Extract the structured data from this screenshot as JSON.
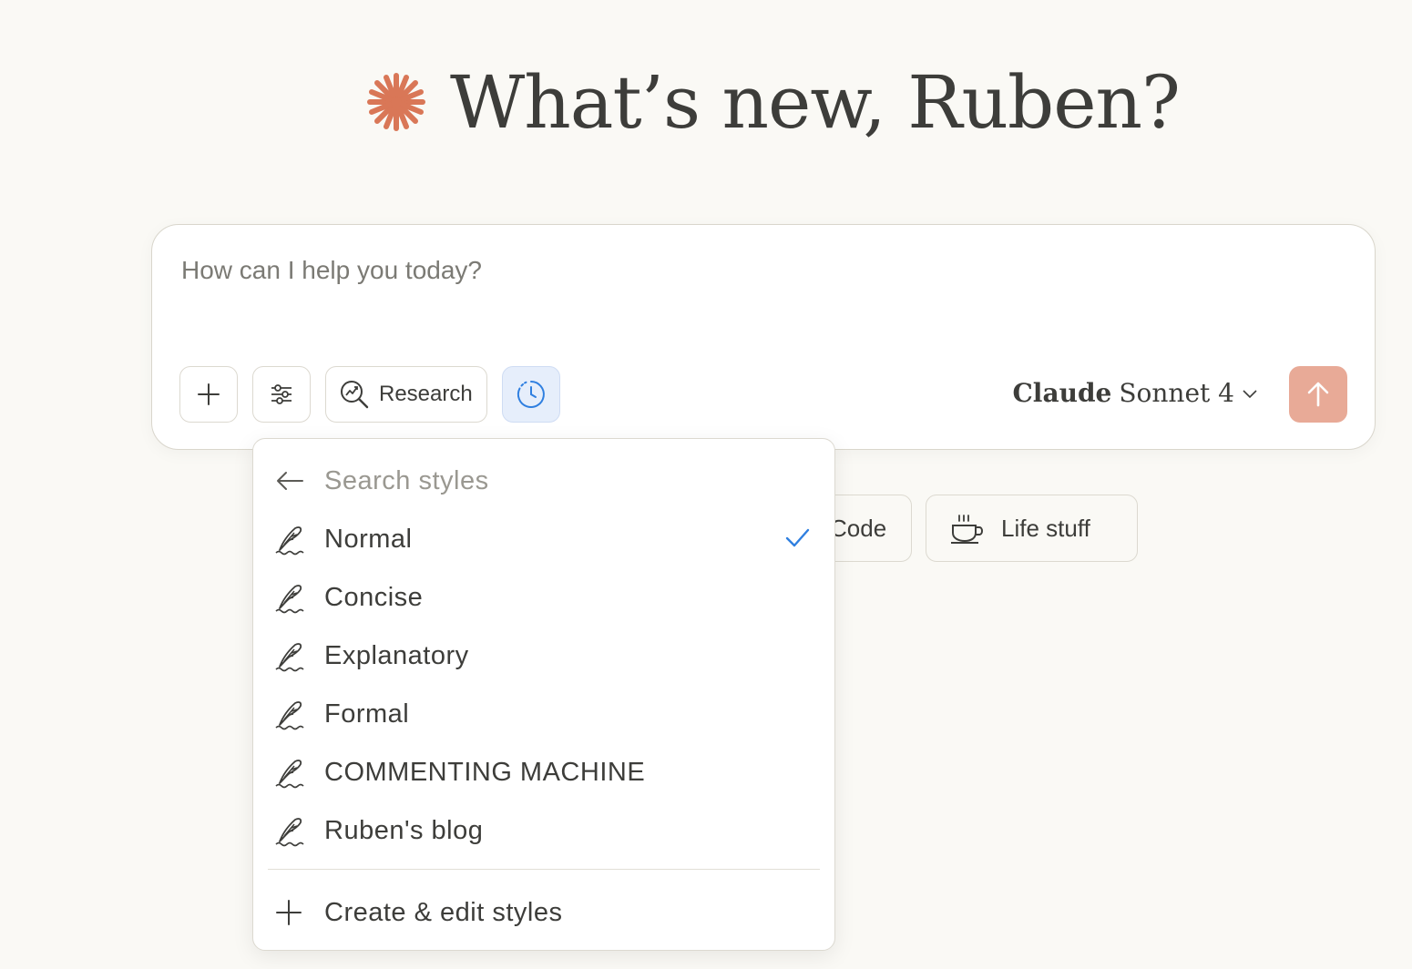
{
  "greeting": {
    "text": "What’s new, Ruben?",
    "accent": "#d97757"
  },
  "composer": {
    "placeholder": "How can I help you today?",
    "research_label": "Research",
    "model_brand": "Claude",
    "model_name": "Sonnet 4",
    "send_color": "#e8aa97"
  },
  "chips": [
    {
      "label": "Code",
      "icon": "code-icon"
    },
    {
      "label": "Life stuff",
      "icon": "coffee-cup-icon"
    }
  ],
  "styles_menu": {
    "search_placeholder": "Search styles",
    "items": [
      {
        "label": "Normal",
        "selected": true,
        "icon": "quill-icon"
      },
      {
        "label": "Concise",
        "selected": false,
        "icon": "quill-icon"
      },
      {
        "label": "Explanatory",
        "selected": false,
        "icon": "quill-icon"
      },
      {
        "label": "Formal",
        "selected": false,
        "icon": "quill-icon"
      },
      {
        "label": "COMMENTING MACHINE",
        "selected": false,
        "icon": "quill-icon"
      },
      {
        "label": "Ruben's blog",
        "selected": false,
        "icon": "quill-icon"
      }
    ],
    "create_label": "Create & edit styles",
    "check_color": "#2f7fe0"
  }
}
